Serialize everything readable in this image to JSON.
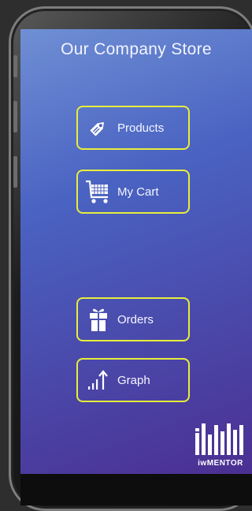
{
  "header": {
    "title": "Our Company Store"
  },
  "menu": [
    {
      "label": "Products",
      "icon": "tag-icon"
    },
    {
      "label": "My Cart",
      "icon": "cart-icon"
    },
    {
      "label": "Orders",
      "icon": "gift-icon"
    },
    {
      "label": "Graph",
      "icon": "chart-icon"
    }
  ],
  "logo": {
    "text": "iwMENTOR"
  },
  "colors": {
    "button_border": "#e8ee3a",
    "screen_gradient_start": "#6f8fd4",
    "screen_gradient_end": "#4b2f92"
  }
}
